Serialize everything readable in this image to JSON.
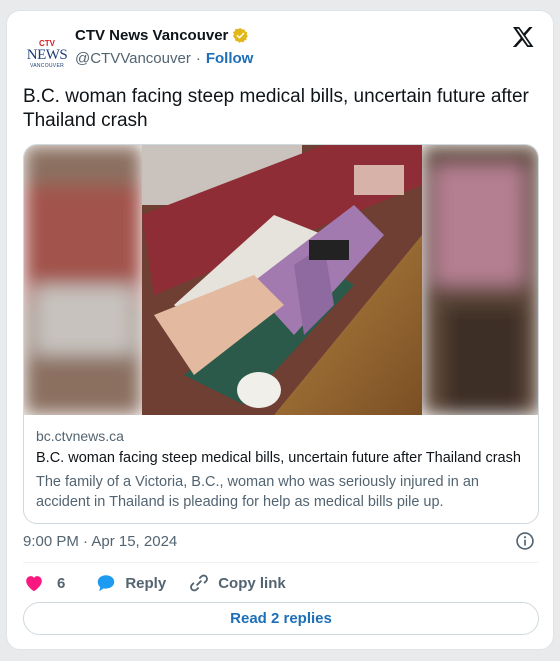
{
  "author": {
    "display_name": "CTV News Vancouver",
    "handle": "@CTVVancouver",
    "separator": "·",
    "follow_label": "Follow",
    "avatar": {
      "brand_mark": "CTV",
      "wordmark": "NEWS",
      "city": "VANCOUVER"
    }
  },
  "tweet": {
    "text": "B.C. woman facing steep medical bills, uncertain future after Thailand crash",
    "timestamp": "9:00 PM · Apr 15, 2024"
  },
  "link_card": {
    "domain": "bc.ctvnews.ca",
    "title": "B.C. woman facing steep medical bills, uncertain future after Thailand crash",
    "description": "The family of a Victoria, B.C., woman who was seriously injured in an accident in Thailand is pleading for help as medical bills pile up."
  },
  "actions": {
    "like_count": "6",
    "reply_label": "Reply",
    "copy_link_label": "Copy link",
    "read_replies_label": "Read 2 replies"
  },
  "icons": {
    "platform_logo": "x-logo-icon",
    "verified": "verified-badge-icon",
    "info": "info-icon",
    "like": "heart-icon",
    "reply": "speech-bubble-icon",
    "copy": "link-icon"
  },
  "colors": {
    "accent": "#1d6fb8",
    "like": "#f91880",
    "reply": "#1d9bf0",
    "verified_gold": "#e2b719"
  }
}
